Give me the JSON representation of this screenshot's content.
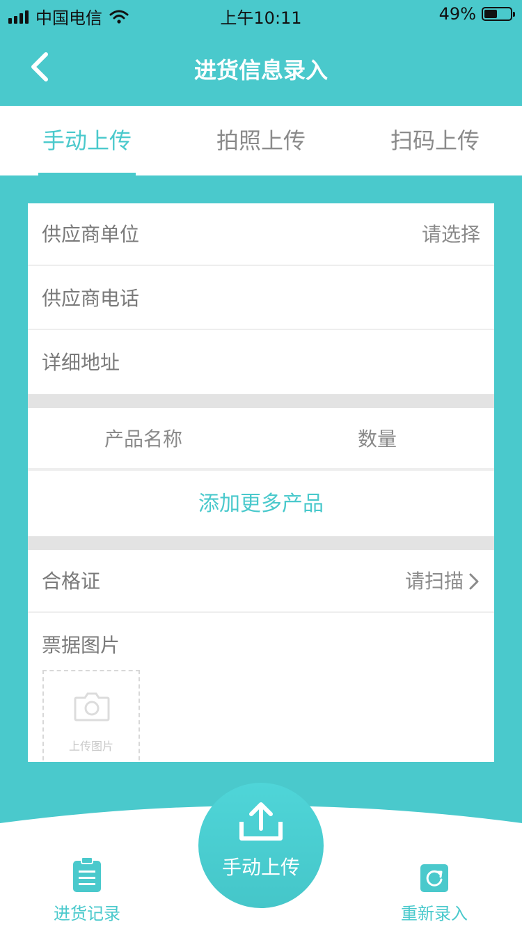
{
  "status_bar": {
    "carrier": "中国电信",
    "time": "上午10:11",
    "battery": "49%",
    "battery_level": 0.49
  },
  "nav": {
    "title": "进货信息录入"
  },
  "tabs": [
    {
      "label": "手动上传",
      "active": true
    },
    {
      "label": "拍照上传",
      "active": false
    },
    {
      "label": "扫码上传",
      "active": false
    }
  ],
  "form": {
    "supplier_unit": {
      "label": "供应商单位",
      "value": "请选择"
    },
    "supplier_phone": {
      "label": "供应商电话"
    },
    "address": {
      "label": "详细地址"
    },
    "product_table": {
      "name_header": "产品名称",
      "qty_header": "数量",
      "add_more": "添加更多产品"
    },
    "certificate": {
      "label": "合格证",
      "value": "请扫描"
    },
    "receipt": {
      "label": "票据图片",
      "upload_caption": "上传图片"
    }
  },
  "bottom_bar": {
    "left_label": "进货记录",
    "center_label": "手动上传",
    "right_label": "重新录入"
  },
  "colors": {
    "accent": "#4ac9cc",
    "divider": "#e3e3e3",
    "text_muted": "#7a7a7a"
  },
  "icons": [
    "signal-icon",
    "wifi-icon",
    "battery-icon",
    "back-icon",
    "chevron-right-icon",
    "camera-icon",
    "upload-icon",
    "clipboard-icon",
    "refresh-icon"
  ]
}
